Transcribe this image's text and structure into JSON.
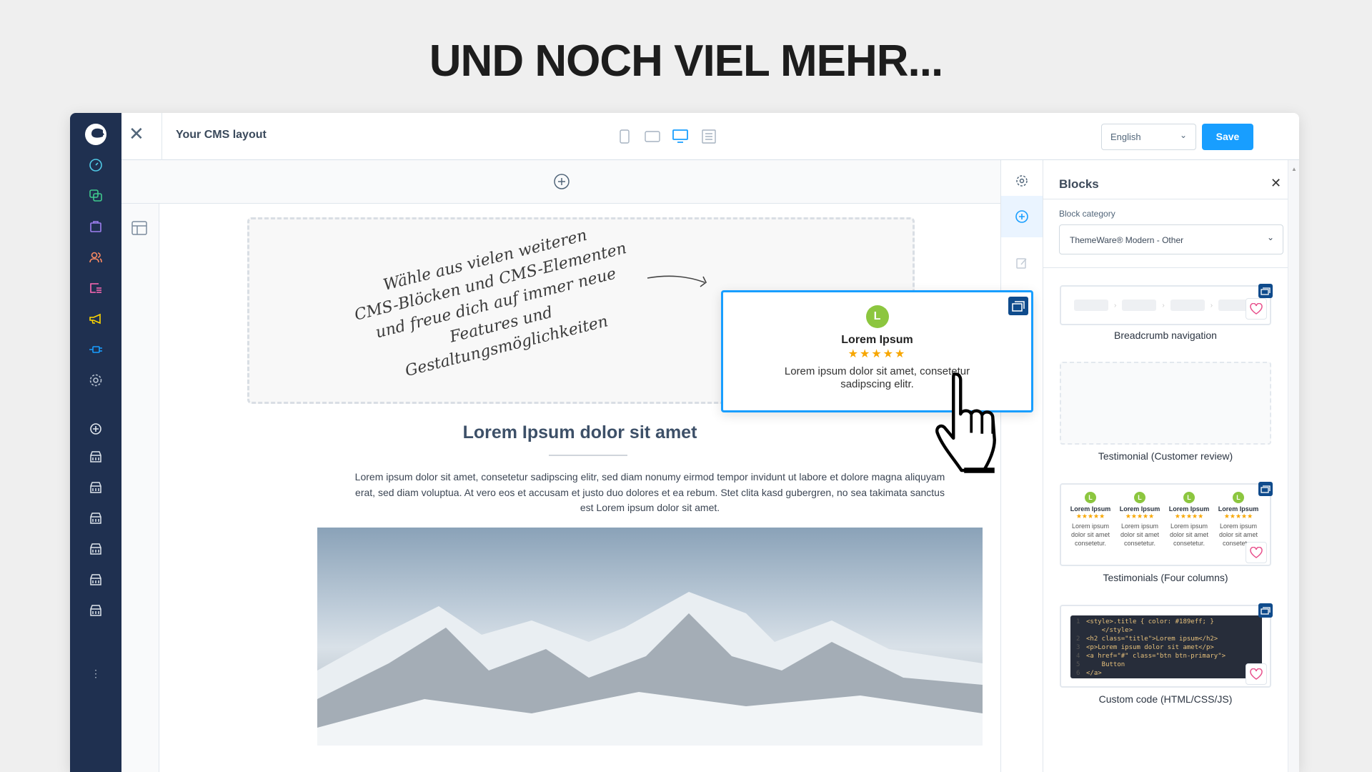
{
  "headline": "UND NOCH VIEL MEHR...",
  "topbar": {
    "title": "Your CMS layout",
    "language": "English",
    "save_label": "Save"
  },
  "sidebar": {
    "icons": [
      "dashboard-icon",
      "catalog-icon",
      "orders-icon",
      "customers-icon",
      "content-icon",
      "marketing-icon",
      "extensions-icon",
      "settings-icon",
      "add-sales-channel-icon",
      "storefront-icon",
      "storefront-icon",
      "storefront-icon",
      "storefront-icon",
      "storefront-icon",
      "storefront-icon",
      "more-icon"
    ],
    "more": "⋮"
  },
  "canvas": {
    "note": "Wähle aus vielen weiteren CMS-Blöcken und CMS-Elementen und freue dich auf immer neue Features und Gestaltungsmöglichkeiten",
    "note_lines": [
      "Wähle aus vielen weiteren",
      "CMS-Blöcken und CMS-Elementen",
      "und freue dich auf immer neue",
      "Features und",
      "Gestaltungsmöglichkeiten"
    ],
    "heading": "Lorem Ipsum dolor sit amet",
    "paragraph": "Lorem ipsum dolor sit amet, consetetur sadipscing elitr, sed diam nonumy eirmod tempor invidunt ut labore et dolore magna aliquyam erat, sed diam voluptua. At vero eos et accusam et justo duo dolores et ea rebum. Stet clita kasd gubergren, no sea takimata sanctus est Lorem ipsum dolor sit amet."
  },
  "drag_card": {
    "avatar": "L",
    "name": "Lorem Ipsum",
    "stars": "★★★★★",
    "rating": 5,
    "text": "Lorem ipsum dolor sit amet, consetetur sadipscing elitr."
  },
  "panel": {
    "title": "Blocks",
    "category_label": "Block category",
    "category_value": "ThemeWare® Modern - Other",
    "blocks": [
      {
        "label": "Breadcrumb navigation"
      },
      {
        "label": "Testimonial (Customer review)"
      },
      {
        "label": "Testimonials (Four columns)",
        "columns": [
          {
            "avatar": "L",
            "name": "Lorem Ipsum",
            "stars": "★★★★★",
            "text": "Lorem ipsum dolor sit amet consetetur."
          },
          {
            "avatar": "L",
            "name": "Lorem Ipsum",
            "stars": "★★★★★",
            "text": "Lorem ipsum dolor sit amet consetetur."
          },
          {
            "avatar": "L",
            "name": "Lorem Ipsum",
            "stars": "★★★★★",
            "text": "Lorem ipsum dolor sit amet consetetur."
          },
          {
            "avatar": "L",
            "name": "Lorem Ipsum",
            "stars": "★★★★★",
            "text": "Lorem ipsum dolor sit amet consetetur."
          }
        ]
      },
      {
        "label": "Custom code (HTML/CSS/JS)",
        "code": [
          "<style>.title { color: #189eff; }",
          "    </style>",
          "<h2 class=\"title\">Lorem ipsum</h2>",
          "<p>Lorem ipsum dolor sit amet</p>",
          "<a href=\"#\" class=\"btn btn-primary\">",
          "    Button",
          "</a>"
        ]
      }
    ]
  },
  "colors": {
    "sidebar": "#1f3050",
    "accent": "#189eff",
    "avatar": "#8cc63f",
    "star": "#f7a600",
    "heart": "#e8508c"
  }
}
